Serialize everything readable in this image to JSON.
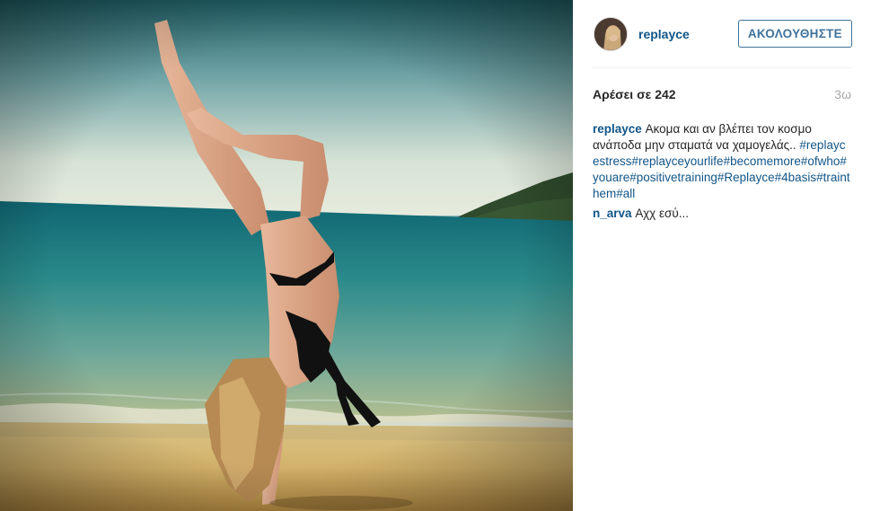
{
  "post": {
    "username": "replayce",
    "follow_label": "ΑΚΟΛΟΥΘΗΣΤΕ",
    "likes_text": "Αρέσει σε 242",
    "age": "3ω"
  },
  "comments": [
    {
      "author": "replayce",
      "text": "Ακομα και αν βλέπει τον κοσμο ανάποδα μην σταματά να χαμογελάς..",
      "hashtags": "#replaycestress#replayceyourlife#becomemore#ofwho#youare#positivetraining#Replayce#4basis#trainthem#all"
    },
    {
      "author": "n_arva",
      "text": "Αχχ εσύ..."
    }
  ],
  "icons": {
    "avatar": "profile-photo"
  },
  "colors": {
    "link": "#125688",
    "follow_border": "#3f729b",
    "muted": "#a5a7aa"
  }
}
